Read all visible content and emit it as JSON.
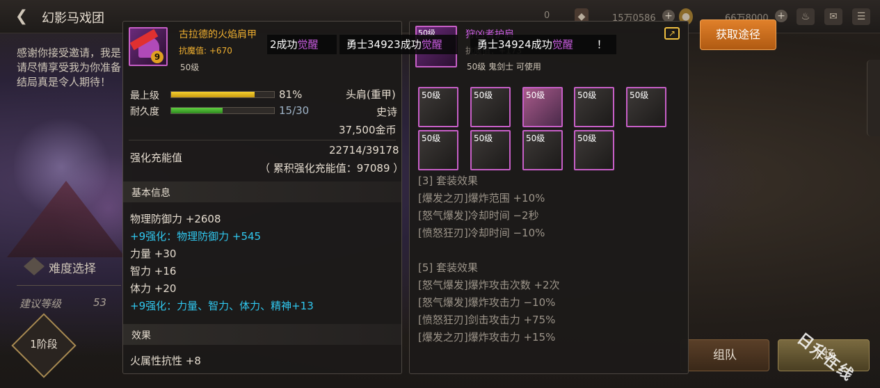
{
  "scene": {
    "title": "幻影马戏团",
    "intro_text": "感谢你接受邀请，我是\n请尽情享受我为你准备\n结局真是令人期待！",
    "difficulty_label": "难度选择",
    "recommended_level_label": "建议等级",
    "recommended_level_value": "53",
    "stage_label": "1阶段",
    "team_button": "组队",
    "enter_button": "入场",
    "currency_1": "0",
    "currency_2": "15万0586",
    "currency_3": "66万8000"
  },
  "left_item": {
    "name": "古拉德的火焰肩甲",
    "resist_label": "抗魔值",
    "resist_value": "+670",
    "level": "50级",
    "plus_level": "9",
    "max_level_label": "最上级",
    "max_level_pct": "81%",
    "max_level_fill": 0.81,
    "durability_label": "耐久度",
    "durability_value": "15/30",
    "durability_fill": 0.5,
    "slot": "头肩(重甲)",
    "rarity": "史诗",
    "price": "37,500金币",
    "charge_label": "强化充能值",
    "charge_value": "22714/39178",
    "charge_total": "（ 累积强化充能值：97089 ）",
    "basic_info_header": "基本信息",
    "stats": [
      {
        "text": "物理防御力 +2608",
        "highlight": false
      },
      {
        "text": "+9强化：物理防御力 +545",
        "highlight": true
      },
      {
        "text": "力量 +30",
        "highlight": false
      },
      {
        "text": "智力 +16",
        "highlight": false
      },
      {
        "text": "体力 +20",
        "highlight": false
      },
      {
        "text": "+9强化：力量、智力、体力、精神+13",
        "highlight": true
      }
    ],
    "effect_header": "效果",
    "effect_line": "火属性抗性 +8"
  },
  "right_item": {
    "name": "狩凶者护肩",
    "resist_text": "抗魔值：+173",
    "level_class": "50级 鬼剑士 可使用",
    "level_tag": "50级",
    "set_slots": [
      "50级",
      "50级",
      "50级",
      "50级",
      "50级",
      "50级",
      "50级",
      "50级",
      "50级"
    ],
    "set_effects": [
      "[3] 套装效果",
      "[爆发之刃]爆炸范围 +10%",
      "[怒气爆发]冷却时间 −2秒",
      "[愤怒狂刃]冷却时间 −10%",
      "",
      "[5] 套装效果",
      "[怒气爆发]爆炸攻击次数 +2次",
      "[怒气爆发]爆炸攻击力 −10%",
      "[愤怒狂刃]剑击攻击力 +75%",
      "[爆发之刃]爆炸攻击力 +15%"
    ]
  },
  "obtain_button": "获取途径",
  "broadcast": {
    "msg1_prefix": "2成功",
    "msg1_awaken": "觉醒",
    "msg2_prefix": "勇士34923成功",
    "msg2_awaken": "觉醒",
    "msg3_prefix": "勇士34924成功",
    "msg3_awaken": "觉醒",
    "trail": "！"
  },
  "watermark": "日升在线",
  "colors": {
    "epic": "#f0b030",
    "awaken": "#c95ce0",
    "enhance": "#30c8f0",
    "obtain_button": "#e0802a"
  }
}
